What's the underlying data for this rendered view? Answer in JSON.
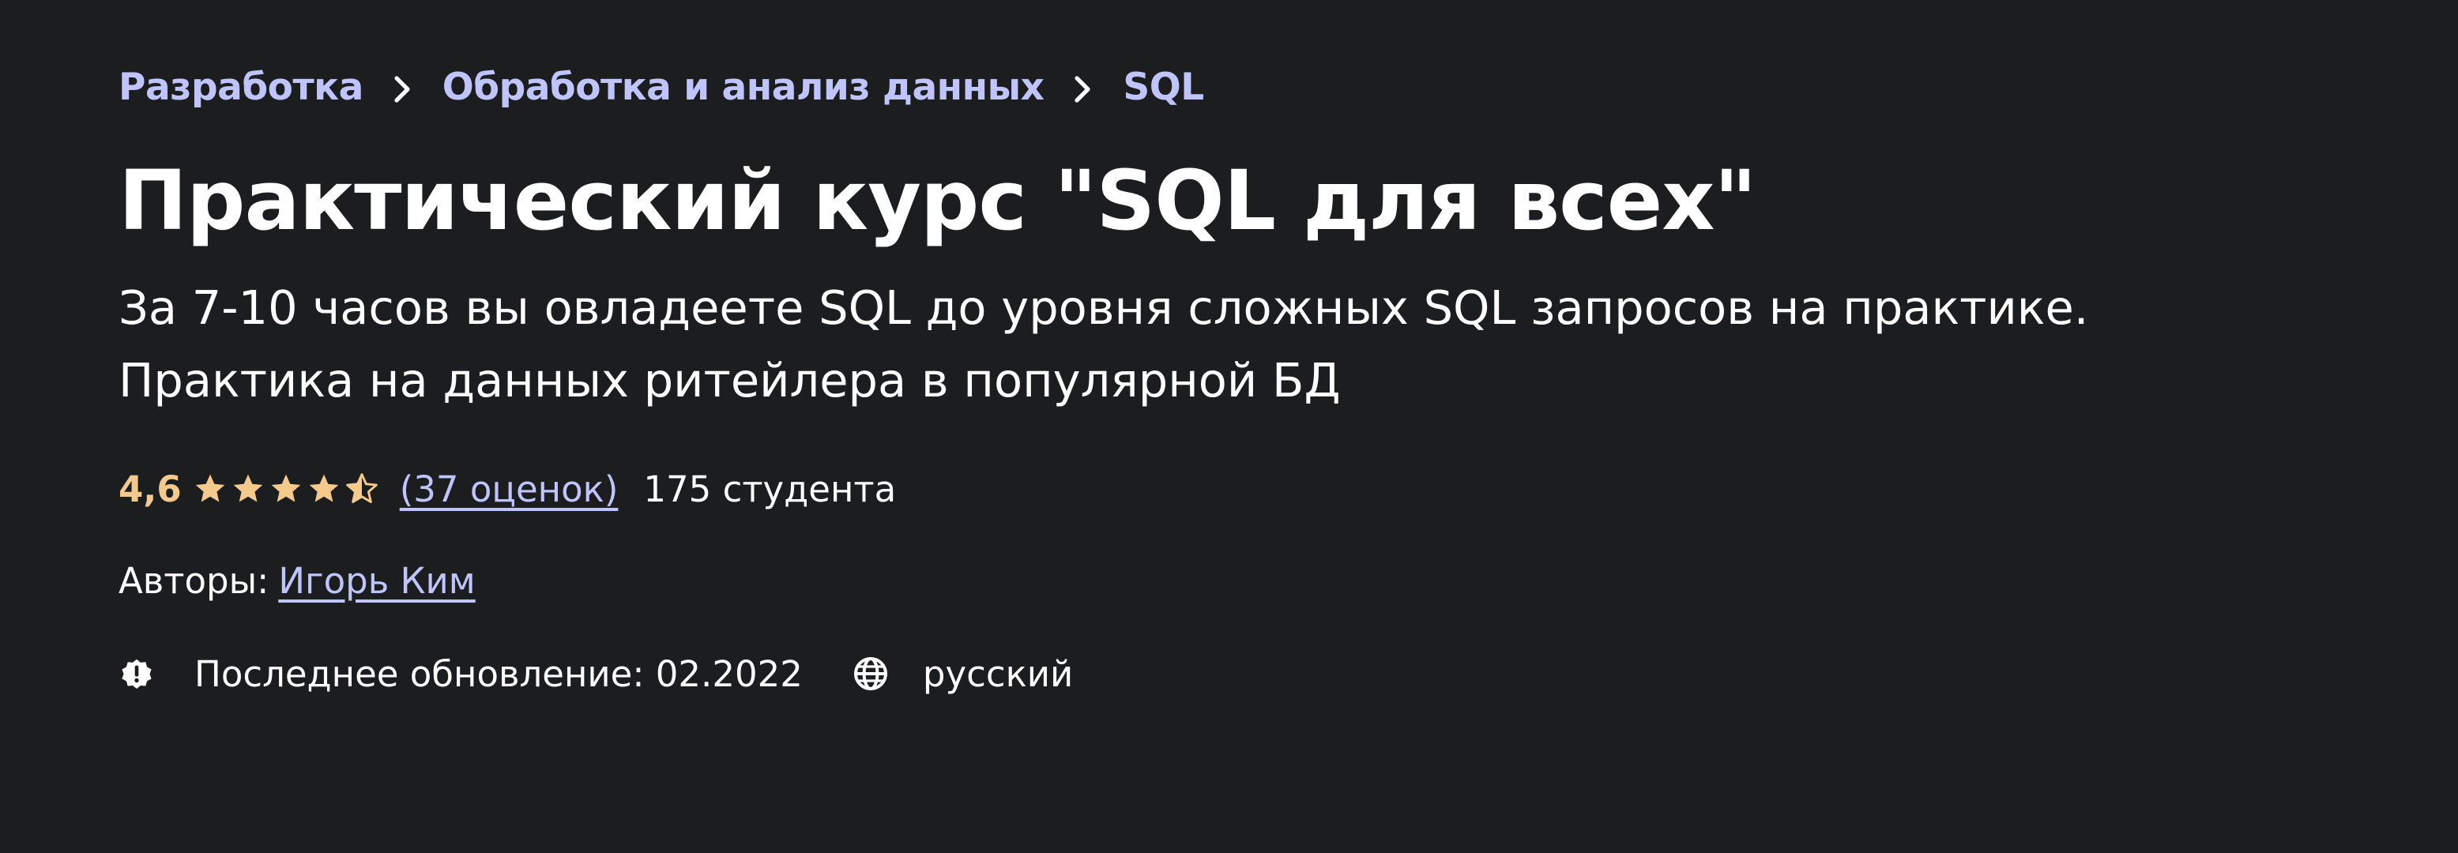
{
  "breadcrumb": {
    "items": [
      "Разработка",
      "Обработка и анализ данных",
      "SQL"
    ]
  },
  "course": {
    "title": "Практический курс \"SQL для всех\"",
    "subtitle_line1": "За 7-10 часов вы овладеете SQL до уровня сложных SQL запросов на практике.",
    "subtitle_line2": "Практика на данных ритейлера в популярной БД"
  },
  "rating": {
    "value": "4,6",
    "stars_filled": 4.5,
    "stars_total": 5,
    "count_label": "(37 оценок)",
    "students": "175 студента"
  },
  "authors": {
    "label": "Авторы:",
    "name": "Игорь Ким"
  },
  "meta": {
    "updated": "Последнее обновление: 02.2022",
    "language": "русский"
  },
  "colors": {
    "background": "#1c1d1f",
    "link": "#c0c4fc",
    "rating": "#f3ca8c",
    "text": "#ffffff"
  },
  "icons": {
    "breadcrumb_separator": "chevron-right-icon",
    "star": "star-icon",
    "update": "alert-badge-icon",
    "language": "globe-icon"
  }
}
